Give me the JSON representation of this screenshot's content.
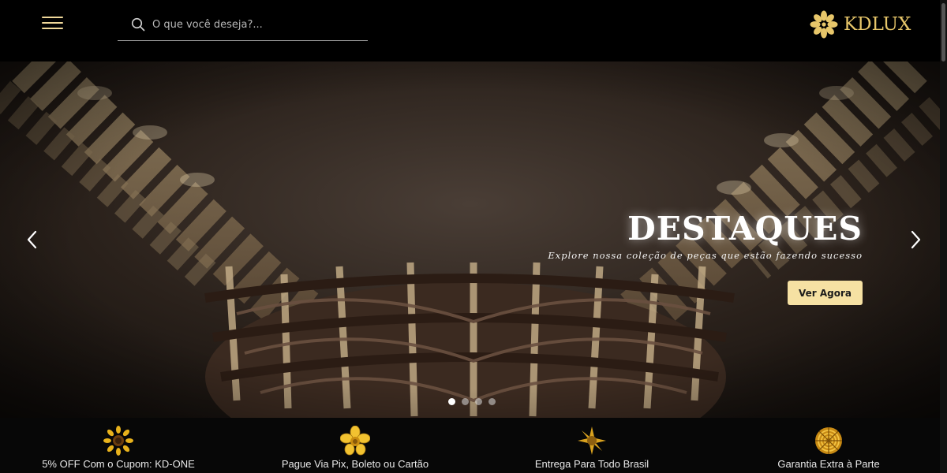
{
  "header": {
    "search_placeholder": "O que você deseja?...",
    "logo_text": "KDLUX"
  },
  "hero": {
    "title": "DESTAQUES",
    "subtitle": "Explore nossa coleção de peças que estão fazendo sucesso",
    "cta_label": "Ver Agora",
    "slide_count": 4,
    "active_slide": 1
  },
  "features": [
    {
      "label": "5% OFF Com o Cupom: KD-ONE",
      "icon": "sunflower-icon"
    },
    {
      "label": "Pague Via Pix, Boleto ou Cartão",
      "icon": "gold-flower-icon"
    },
    {
      "label": "Entrega Para Todo Brasil",
      "icon": "gold-star-flower-icon"
    },
    {
      "label": "Garantia Extra à Parte",
      "icon": "gold-rose-icon"
    }
  ],
  "colors": {
    "accent_gold": "#e7c66a",
    "cta_background": "#f6e1a3",
    "page_background": "#000000"
  }
}
